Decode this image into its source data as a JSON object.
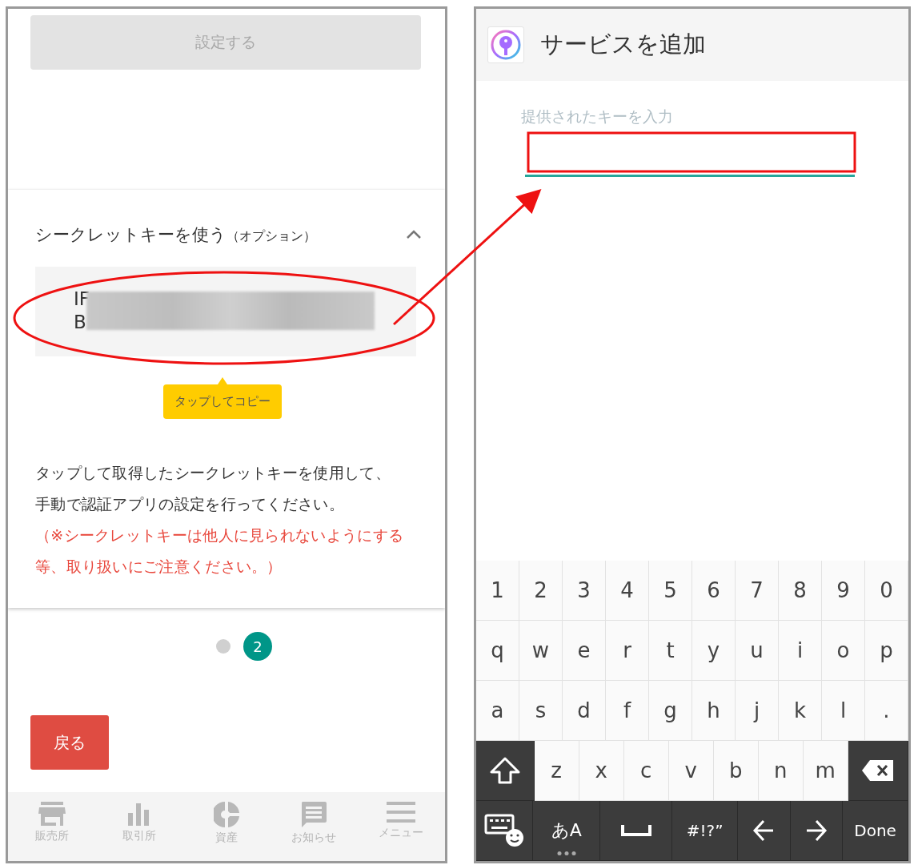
{
  "left_screen": {
    "set_button": {
      "label": "設定する",
      "disabled": true
    },
    "secret_section": {
      "title": "シークレットキーを使う",
      "title_note": "（オプション）",
      "expanded": true,
      "key_lines": [
        {
          "start": "IF"
        },
        {
          "start": "B"
        }
      ],
      "copy_tip": "タップしてコピー",
      "instructions": "タップして取得したシークレットキーを使用して、手動で認証アプリの設定を行ってください。",
      "warning": "（※シークレットキーは他人に見られないようにする等、取り扱いにご注意ください。）"
    },
    "pager": [
      {
        "selected": false
      },
      {
        "label": "2",
        "selected": true
      }
    ],
    "back_button": "戻る",
    "bottom_nav": [
      {
        "kind": "store",
        "label": "販売所"
      },
      {
        "kind": "chart",
        "label": "取引所"
      },
      {
        "kind": "pie",
        "label": "資産"
      },
      {
        "kind": "message",
        "label": "お知らせ"
      },
      {
        "kind": "menu",
        "label": "メニュー"
      }
    ]
  },
  "right_screen": {
    "title": "サービスを追加",
    "key_field": {
      "label": "提供されたキーを入力",
      "focused": true
    },
    "keyboard": {
      "rows": [
        [
          {
            "kind": "char",
            "label": "1"
          },
          {
            "kind": "char",
            "label": "2"
          },
          {
            "kind": "char",
            "label": "3"
          },
          {
            "kind": "char",
            "label": "4"
          },
          {
            "kind": "char",
            "label": "5"
          },
          {
            "kind": "char",
            "label": "6"
          },
          {
            "kind": "char",
            "label": "7"
          },
          {
            "kind": "char",
            "label": "8"
          },
          {
            "kind": "char",
            "label": "9"
          },
          {
            "kind": "char",
            "label": "0"
          }
        ],
        [
          {
            "kind": "char",
            "label": "q"
          },
          {
            "kind": "char",
            "label": "w"
          },
          {
            "kind": "char",
            "label": "e"
          },
          {
            "kind": "char",
            "label": "r"
          },
          {
            "kind": "char",
            "label": "t"
          },
          {
            "kind": "char",
            "label": "y"
          },
          {
            "kind": "char",
            "label": "u"
          },
          {
            "kind": "char",
            "label": "i"
          },
          {
            "kind": "char",
            "label": "o"
          },
          {
            "kind": "char",
            "label": "p"
          }
        ],
        [
          {
            "kind": "char",
            "label": "a"
          },
          {
            "kind": "char",
            "label": "s"
          },
          {
            "kind": "char",
            "label": "d"
          },
          {
            "kind": "char",
            "label": "f"
          },
          {
            "kind": "char",
            "label": "g"
          },
          {
            "kind": "char",
            "label": "h"
          },
          {
            "kind": "char",
            "label": "j"
          },
          {
            "kind": "char",
            "label": "k"
          },
          {
            "kind": "char",
            "label": "l"
          },
          {
            "kind": "char",
            "label": "."
          }
        ],
        [
          {
            "kind": "shift"
          },
          {
            "kind": "char",
            "label": "z"
          },
          {
            "kind": "char",
            "label": "x"
          },
          {
            "kind": "char",
            "label": "c"
          },
          {
            "kind": "char",
            "label": "v"
          },
          {
            "kind": "char",
            "label": "b"
          },
          {
            "kind": "char",
            "label": "n"
          },
          {
            "kind": "char",
            "label": "m"
          },
          {
            "kind": "backspace"
          }
        ]
      ],
      "bottom_keys": [
        {
          "kind": "emoji"
        },
        {
          "kind": "lang",
          "label": "あA"
        },
        {
          "kind": "space"
        },
        {
          "kind": "action",
          "label": "#!?”"
        },
        {
          "kind": "left"
        },
        {
          "kind": "right"
        },
        {
          "kind": "action",
          "label": "Done"
        }
      ]
    }
  }
}
